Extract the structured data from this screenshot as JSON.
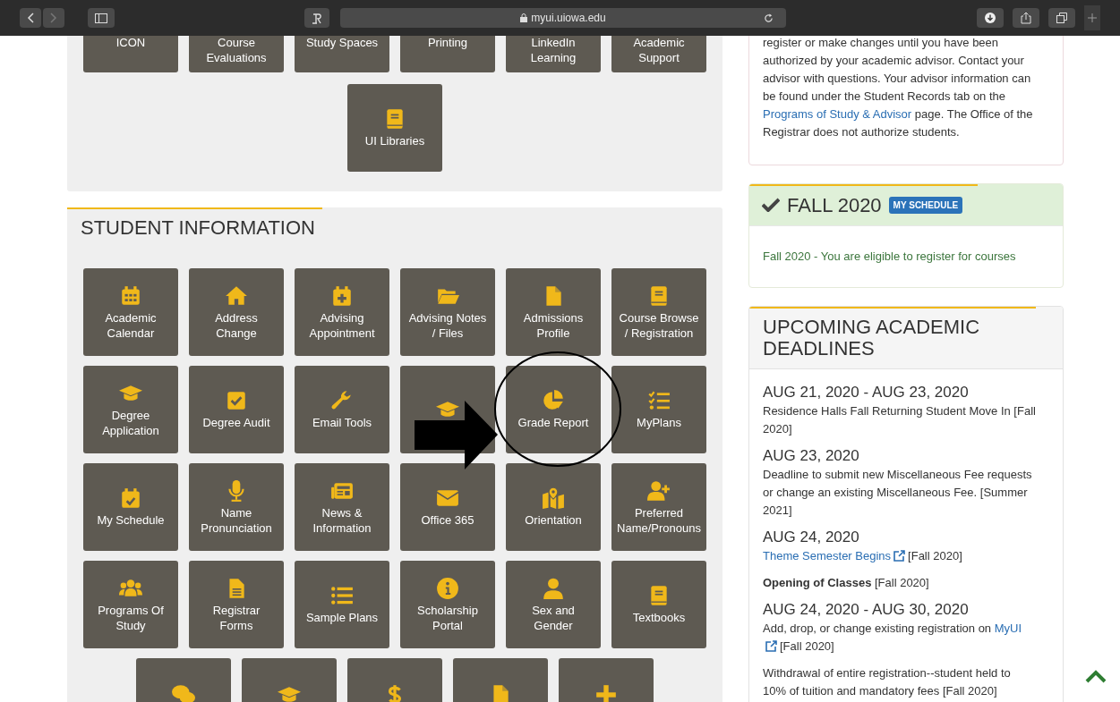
{
  "browser": {
    "url": "myui.uiowa.edu"
  },
  "top_panel": {
    "tiles": [
      {
        "label": "ICON"
      },
      {
        "label": "Course\nEvaluations"
      },
      {
        "label": "Study Spaces"
      },
      {
        "label": "Printing"
      },
      {
        "label": "LinkedIn\nLearning"
      },
      {
        "label": "Academic\nSupport"
      }
    ],
    "extra_tiles": [
      {
        "label": "UI Libraries"
      }
    ]
  },
  "student_information": {
    "title": "STUDENT INFORMATION",
    "tiles": [
      {
        "kind": "labeled",
        "label": "Academic\nCalendar"
      },
      {
        "kind": "labeled",
        "label": "Address\nChange"
      },
      {
        "kind": "labeled",
        "label": "Advising\nAppointment"
      },
      {
        "kind": "labeled",
        "label": "Advising Notes\n/ Files"
      },
      {
        "kind": "labeled",
        "label": "Admissions\nProfile"
      },
      {
        "kind": "labeled",
        "label": "Course Browse\n/ Registration"
      },
      {
        "kind": "labeled",
        "label": "Degree\nApplication"
      },
      {
        "kind": "labeled",
        "label": "Degree Audit"
      },
      {
        "kind": "labeled",
        "label": "Email Tools"
      },
      {
        "kind": "covered"
      },
      {
        "kind": "labeled",
        "label": "Grade Report"
      },
      {
        "kind": "labeled",
        "label": "MyPlans"
      },
      {
        "kind": "labeled",
        "label": "My Schedule"
      },
      {
        "kind": "labeled",
        "label": "Name\nPronunciation"
      },
      {
        "kind": "labeled",
        "label": "News &\nInformation"
      },
      {
        "kind": "labeled",
        "label": "Office 365"
      },
      {
        "kind": "labeled",
        "label": "Orientation"
      },
      {
        "kind": "labeled",
        "label": "Preferred\nName/Pronouns"
      },
      {
        "kind": "labeled",
        "label": "Programs Of\nStudy"
      },
      {
        "kind": "labeled",
        "label": "Registrar\nForms"
      },
      {
        "kind": "labeled",
        "label": "Sample Plans"
      },
      {
        "kind": "labeled",
        "label": "Scholarship\nPortal"
      },
      {
        "kind": "labeled",
        "label": "Sex and\nGender"
      },
      {
        "kind": "labeled",
        "label": "Textbooks"
      }
    ]
  },
  "advisor_notice": {
    "text_before": "register or make changes until you have been authorized by your academic advisor. Contact your advisor with questions. Your advisor information can be found under the Student Records tab on the",
    "link": "Programs of Study & Advisor",
    "text_after": "page. The Office of the Registrar does not authorize students."
  },
  "term_card": {
    "term": "FALL 2020",
    "badge": "MY SCHEDULE",
    "message": "Fall 2020 - You are eligible to register for courses"
  },
  "deadlines": {
    "title": "UPCOMING ACADEMIC DEADLINES",
    "items": [
      {
        "date": "AUG 21, 2020 - AUG 23, 2020",
        "entries": [
          {
            "text": "Residence Halls Fall Returning Student Move In [Fall 2020]"
          }
        ]
      },
      {
        "date": "AUG 23, 2020",
        "entries": [
          {
            "text": "Deadline to submit new Miscellaneous Fee requests or change an existing Miscellaneous Fee. [Summer 2021]"
          }
        ]
      },
      {
        "date": "AUG 24, 2020",
        "entries": [
          {
            "link": "Theme Semester Begins",
            "after": "[Fall 2020]"
          },
          {
            "text": "**Opening of Classes** [Fall 2020]"
          }
        ]
      },
      {
        "date": "AUG 24, 2020 - AUG 30, 2020",
        "entries": [
          {
            "text": "Add, drop, or change existing registration on",
            "link": "MyUI",
            "after": "[Fall 2020]"
          },
          {
            "text": "Withdrawal of entire registration--student held to 10% of tuition and mandatory fees [Fall 2020]"
          }
        ]
      }
    ]
  }
}
